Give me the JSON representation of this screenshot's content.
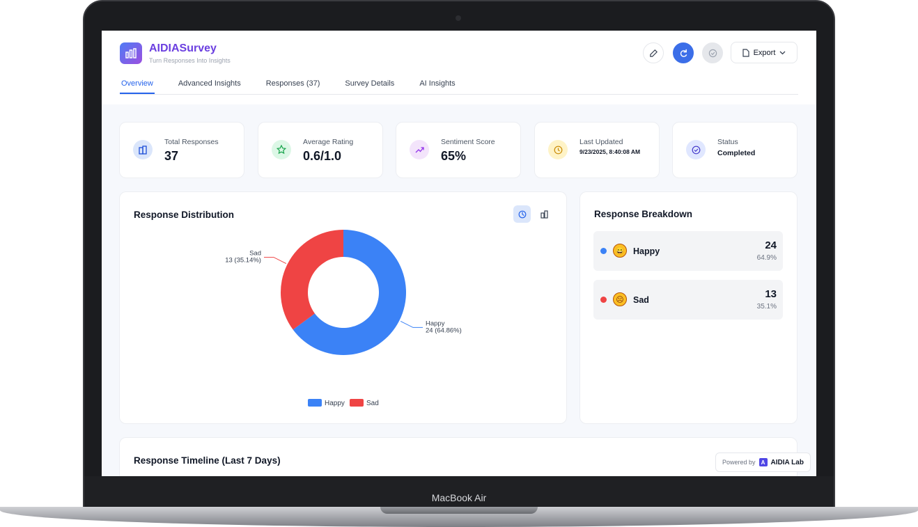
{
  "device": {
    "label": "MacBook Air"
  },
  "app": {
    "name": "AIDIASurvey",
    "tagline": "Turn Responses Into Insights"
  },
  "header": {
    "export_label": "Export"
  },
  "tabs": [
    {
      "label": "Overview",
      "active": true
    },
    {
      "label": "Advanced Insights"
    },
    {
      "label": "Responses (37)"
    },
    {
      "label": "Survey Details"
    },
    {
      "label": "AI Insights"
    }
  ],
  "stats": [
    {
      "label": "Total Responses",
      "value": "37",
      "icon": "document-icon",
      "color": "#dbe6fb"
    },
    {
      "label": "Average Rating",
      "value": "0.6/1.0",
      "icon": "star-icon",
      "color": "#dcf7e6"
    },
    {
      "label": "Sentiment Score",
      "value": "65%",
      "icon": "trending-up-icon",
      "color": "#f3e4fb"
    },
    {
      "label": "Last Updated",
      "value": "9/23/2025, 8:40:08 AM",
      "icon": "clock-icon",
      "color": "#fef3c7"
    },
    {
      "label": "Status",
      "value": "Completed",
      "icon": "check-circle-icon",
      "color": "#e0e7ff"
    }
  ],
  "distribution": {
    "title": "Response Distribution",
    "legend": [
      "Happy",
      "Sad"
    ]
  },
  "chart_data": {
    "type": "pie",
    "donut": true,
    "categories": [
      "Happy",
      "Sad"
    ],
    "values": [
      24,
      13
    ],
    "labels": [
      "24 (64.86%)",
      "13 (35.14%)"
    ],
    "colors": [
      "#3b82f6",
      "#ef4444"
    ],
    "legend_position": "bottom"
  },
  "breakdown": {
    "title": "Response Breakdown",
    "rows": [
      {
        "label": "Happy",
        "count": "24",
        "pct": "64.9%",
        "color": "#3b82f6",
        "emoji": "😄"
      },
      {
        "label": "Sad",
        "count": "13",
        "pct": "35.1%",
        "color": "#ef4444",
        "emoji": "☹"
      }
    ]
  },
  "timeline": {
    "title": "Response Timeline (Last 7 Days)"
  },
  "powered": {
    "prefix": "Powered by",
    "brand": "AIDIA Lab",
    "logo": "A"
  }
}
